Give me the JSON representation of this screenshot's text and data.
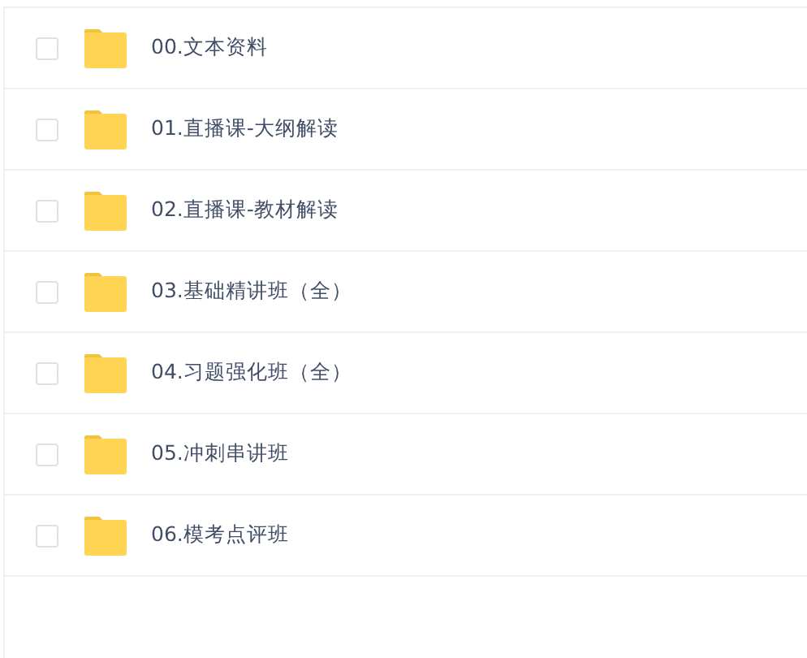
{
  "files": [
    {
      "name": "00.文本资料",
      "checked": false
    },
    {
      "name": "01.直播课-大纲解读",
      "checked": false
    },
    {
      "name": "02.直播课-教材解读",
      "checked": false
    },
    {
      "name": "03.基础精讲班（全）",
      "checked": false
    },
    {
      "name": "04.习题强化班（全）",
      "checked": false
    },
    {
      "name": "05.冲刺串讲班",
      "checked": false
    },
    {
      "name": "06.模考点评班",
      "checked": false
    }
  ]
}
